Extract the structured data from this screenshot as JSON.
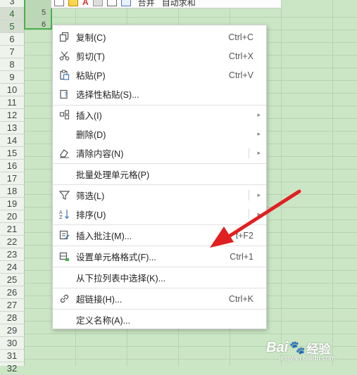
{
  "spreadsheet": {
    "row_numbers": [
      "3",
      "4",
      "5",
      "6",
      "7",
      "8",
      "9",
      "10",
      "11",
      "12",
      "13",
      "14",
      "15",
      "16",
      "17",
      "18",
      "19",
      "20",
      "21",
      "22",
      "23",
      "24",
      "25",
      "26",
      "27",
      "28",
      "29",
      "30",
      "31",
      "32"
    ],
    "cell_values": [
      "5",
      "6"
    ]
  },
  "mini_toolbar": {
    "font_color_label": "A",
    "merge_label": "合并",
    "autosum_label": "自动求和"
  },
  "context_menu": {
    "items": [
      {
        "label": "复制(C)",
        "shortcut": "Ctrl+C",
        "icon": "copy-icon"
      },
      {
        "label": "剪切(T)",
        "shortcut": "Ctrl+X",
        "icon": "scissors-icon"
      },
      {
        "label": "粘贴(P)",
        "shortcut": "Ctrl+V",
        "icon": "paste-icon"
      },
      {
        "label": "选择性粘贴(S)...",
        "shortcut": "",
        "icon": "paste-special-icon"
      },
      {
        "label": "插入(I)",
        "shortcut": "",
        "icon": "insert-icon"
      },
      {
        "label": "删除(D)",
        "shortcut": "",
        "icon": ""
      },
      {
        "label": "清除内容(N)",
        "shortcut": "",
        "icon": "eraser-icon"
      },
      {
        "label": "批量处理单元格(P)",
        "shortcut": "",
        "icon": ""
      },
      {
        "label": "筛选(L)",
        "shortcut": "",
        "icon": "filter-icon"
      },
      {
        "label": "排序(U)",
        "shortcut": "",
        "icon": "sort-icon"
      },
      {
        "label": "插入批注(M)...",
        "shortcut": "t+F2",
        "icon": "comment-icon"
      },
      {
        "label": "设置单元格格式(F)...",
        "shortcut": "Ctrl+1",
        "icon": "format-cells-icon"
      },
      {
        "label": "从下拉列表中选择(K)...",
        "shortcut": "",
        "icon": ""
      },
      {
        "label": "超链接(H)...",
        "shortcut": "Ctrl+K",
        "icon": "link-icon"
      },
      {
        "label": "定义名称(A)...",
        "shortcut": "",
        "icon": ""
      }
    ],
    "submenu_arrow": "▸"
  },
  "colors": {
    "sheet_background": "#cbe6c5",
    "selection_border": "#4caf50",
    "annotation_arrow": "#e02020"
  },
  "watermark": {
    "brand": "Bai",
    "paw": "🐾",
    "cn": "经验",
    "url": "jingyan.baidu.com"
  }
}
